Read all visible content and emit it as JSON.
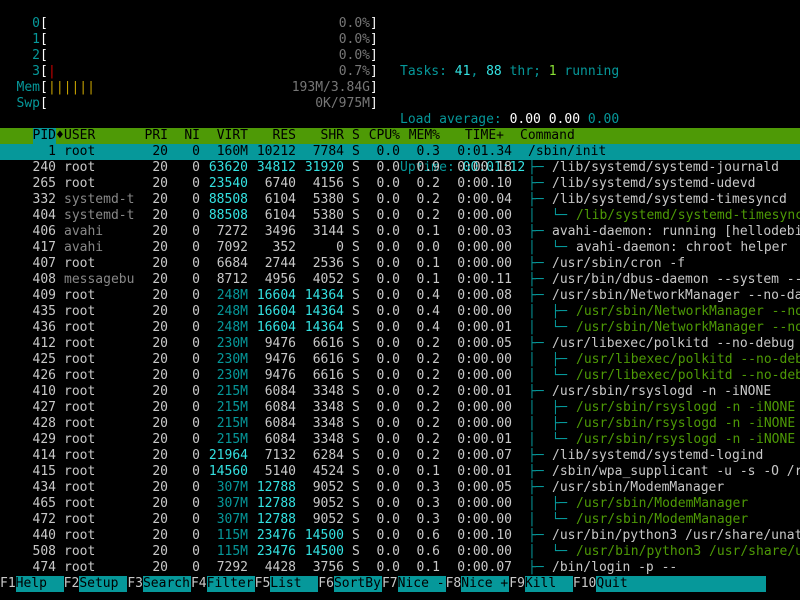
{
  "meters": [
    {
      "label": "0",
      "bar": "",
      "bar_color": "#4e9a06",
      "value": "0.0%"
    },
    {
      "label": "1",
      "bar": "",
      "bar_color": "#4e9a06",
      "value": "0.0%"
    },
    {
      "label": "2",
      "bar": "",
      "bar_color": "#4e9a06",
      "value": "0.0%"
    },
    {
      "label": "3",
      "bar": "|",
      "bar_color": "#cc0000",
      "value": "0.7%"
    },
    {
      "label": "Mem",
      "bar": "||||||",
      "bar_color": "#c4a000",
      "value": "193M/3.84G"
    },
    {
      "label": "Swp",
      "bar": "",
      "bar_color": "#cc0000",
      "value": "0K/975M"
    }
  ],
  "summary": {
    "tasks_label": "Tasks: ",
    "tasks": "41",
    "thr_sep": ", ",
    "thr": "88",
    "thr_label": " thr; ",
    "running": "1",
    "running_label": " running",
    "load_label": "Load average: ",
    "load1": "0.00",
    "load5": "0.00",
    "load15": "0.00",
    "uptime_label": "Uptime: ",
    "uptime": "00:01:12"
  },
  "columns": [
    "PID",
    "USER",
    "PRI",
    "NI",
    "VIRT",
    "RES",
    "SHR",
    "S",
    "CPU%",
    "MEM%",
    "TIME+",
    "Command"
  ],
  "sort_column": "PID",
  "sort_indicator": "♦",
  "processes": [
    {
      "pid": "1",
      "user": "root",
      "pri": "20",
      "ni": "0",
      "virt": "160M",
      "res": "10212",
      "shr": "7784",
      "s": "S",
      "cpu": "0.0",
      "mem": "0.3",
      "time": "0:01.34",
      "tree": "",
      "cmd": "/sbin/init",
      "thread": false
    },
    {
      "pid": "240",
      "user": "root",
      "pri": "20",
      "ni": "0",
      "virt": "63620",
      "res": "34812",
      "shr": "31920",
      "s": "S",
      "cpu": "0.0",
      "mem": "0.9",
      "time": "0:00.18",
      "tree": "├─ ",
      "cmd": "/lib/systemd/systemd-journald",
      "thread": false
    },
    {
      "pid": "265",
      "user": "root",
      "pri": "20",
      "ni": "0",
      "virt": "23540",
      "res": "6740",
      "shr": "4156",
      "s": "S",
      "cpu": "0.0",
      "mem": "0.2",
      "time": "0:00.10",
      "tree": "├─ ",
      "cmd": "/lib/systemd/systemd-udevd",
      "thread": false
    },
    {
      "pid": "332",
      "user": "systemd-t",
      "pri": "20",
      "ni": "0",
      "virt": "88508",
      "res": "6104",
      "shr": "5380",
      "s": "S",
      "cpu": "0.0",
      "mem": "0.2",
      "time": "0:00.04",
      "tree": "├─ ",
      "cmd": "/lib/systemd/systemd-timesyncd",
      "thread": false
    },
    {
      "pid": "404",
      "user": "systemd-t",
      "pri": "20",
      "ni": "0",
      "virt": "88508",
      "res": "6104",
      "shr": "5380",
      "s": "S",
      "cpu": "0.0",
      "mem": "0.2",
      "time": "0:00.00",
      "tree": "│  └─ ",
      "cmd": "/lib/systemd/systemd-timesyncd",
      "thread": true
    },
    {
      "pid": "406",
      "user": "avahi",
      "pri": "20",
      "ni": "0",
      "virt": "7272",
      "res": "3496",
      "shr": "3144",
      "s": "S",
      "cpu": "0.0",
      "mem": "0.1",
      "time": "0:00.03",
      "tree": "├─ ",
      "cmd": "avahi-daemon: running [hellodebi",
      "thread": false
    },
    {
      "pid": "417",
      "user": "avahi",
      "pri": "20",
      "ni": "0",
      "virt": "7092",
      "res": "352",
      "shr": "0",
      "s": "S",
      "cpu": "0.0",
      "mem": "0.0",
      "time": "0:00.00",
      "tree": "│  └─ ",
      "cmd": "avahi-daemon: chroot helper",
      "thread": false
    },
    {
      "pid": "407",
      "user": "root",
      "pri": "20",
      "ni": "0",
      "virt": "6684",
      "res": "2744",
      "shr": "2536",
      "s": "S",
      "cpu": "0.0",
      "mem": "0.1",
      "time": "0:00.00",
      "tree": "├─ ",
      "cmd": "/usr/sbin/cron -f",
      "thread": false
    },
    {
      "pid": "408",
      "user": "messagebu",
      "pri": "20",
      "ni": "0",
      "virt": "8712",
      "res": "4956",
      "shr": "4052",
      "s": "S",
      "cpu": "0.0",
      "mem": "0.1",
      "time": "0:00.11",
      "tree": "├─ ",
      "cmd": "/usr/bin/dbus-daemon --system --",
      "thread": false
    },
    {
      "pid": "409",
      "user": "root",
      "pri": "20",
      "ni": "0",
      "virt": "248M",
      "res": "16604",
      "shr": "14364",
      "s": "S",
      "cpu": "0.0",
      "mem": "0.4",
      "time": "0:00.08",
      "tree": "├─ ",
      "cmd": "/usr/sbin/NetworkManager --no-da",
      "thread": false
    },
    {
      "pid": "435",
      "user": "root",
      "pri": "20",
      "ni": "0",
      "virt": "248M",
      "res": "16604",
      "shr": "14364",
      "s": "S",
      "cpu": "0.0",
      "mem": "0.4",
      "time": "0:00.00",
      "tree": "│  ├─ ",
      "cmd": "/usr/sbin/NetworkManager --no",
      "thread": true
    },
    {
      "pid": "436",
      "user": "root",
      "pri": "20",
      "ni": "0",
      "virt": "248M",
      "res": "16604",
      "shr": "14364",
      "s": "S",
      "cpu": "0.0",
      "mem": "0.4",
      "time": "0:00.01",
      "tree": "│  └─ ",
      "cmd": "/usr/sbin/NetworkManager --no",
      "thread": true
    },
    {
      "pid": "412",
      "user": "root",
      "pri": "20",
      "ni": "0",
      "virt": "230M",
      "res": "9476",
      "shr": "6616",
      "s": "S",
      "cpu": "0.0",
      "mem": "0.2",
      "time": "0:00.05",
      "tree": "├─ ",
      "cmd": "/usr/libexec/polkitd --no-debug",
      "thread": false
    },
    {
      "pid": "425",
      "user": "root",
      "pri": "20",
      "ni": "0",
      "virt": "230M",
      "res": "9476",
      "shr": "6616",
      "s": "S",
      "cpu": "0.0",
      "mem": "0.2",
      "time": "0:00.00",
      "tree": "│  ├─ ",
      "cmd": "/usr/libexec/polkitd --no-deb",
      "thread": true
    },
    {
      "pid": "426",
      "user": "root",
      "pri": "20",
      "ni": "0",
      "virt": "230M",
      "res": "9476",
      "shr": "6616",
      "s": "S",
      "cpu": "0.0",
      "mem": "0.2",
      "time": "0:00.00",
      "tree": "│  └─ ",
      "cmd": "/usr/libexec/polkitd --no-deb",
      "thread": true
    },
    {
      "pid": "410",
      "user": "root",
      "pri": "20",
      "ni": "0",
      "virt": "215M",
      "res": "6084",
      "shr": "3348",
      "s": "S",
      "cpu": "0.0",
      "mem": "0.2",
      "time": "0:00.01",
      "tree": "├─ ",
      "cmd": "/usr/sbin/rsyslogd -n -iNONE",
      "thread": false
    },
    {
      "pid": "427",
      "user": "root",
      "pri": "20",
      "ni": "0",
      "virt": "215M",
      "res": "6084",
      "shr": "3348",
      "s": "S",
      "cpu": "0.0",
      "mem": "0.2",
      "time": "0:00.00",
      "tree": "│  ├─ ",
      "cmd": "/usr/sbin/rsyslogd -n -iNONE",
      "thread": true
    },
    {
      "pid": "428",
      "user": "root",
      "pri": "20",
      "ni": "0",
      "virt": "215M",
      "res": "6084",
      "shr": "3348",
      "s": "S",
      "cpu": "0.0",
      "mem": "0.2",
      "time": "0:00.00",
      "tree": "│  ├─ ",
      "cmd": "/usr/sbin/rsyslogd -n -iNONE",
      "thread": true
    },
    {
      "pid": "429",
      "user": "root",
      "pri": "20",
      "ni": "0",
      "virt": "215M",
      "res": "6084",
      "shr": "3348",
      "s": "S",
      "cpu": "0.0",
      "mem": "0.2",
      "time": "0:00.01",
      "tree": "│  └─ ",
      "cmd": "/usr/sbin/rsyslogd -n -iNONE",
      "thread": true
    },
    {
      "pid": "414",
      "user": "root",
      "pri": "20",
      "ni": "0",
      "virt": "21964",
      "res": "7132",
      "shr": "6284",
      "s": "S",
      "cpu": "0.0",
      "mem": "0.2",
      "time": "0:00.07",
      "tree": "├─ ",
      "cmd": "/lib/systemd/systemd-logind",
      "thread": false
    },
    {
      "pid": "415",
      "user": "root",
      "pri": "20",
      "ni": "0",
      "virt": "14560",
      "res": "5140",
      "shr": "4524",
      "s": "S",
      "cpu": "0.0",
      "mem": "0.1",
      "time": "0:00.01",
      "tree": "├─ ",
      "cmd": "/sbin/wpa_supplicant -u -s -O /r",
      "thread": false
    },
    {
      "pid": "434",
      "user": "root",
      "pri": "20",
      "ni": "0",
      "virt": "307M",
      "res": "12788",
      "shr": "9052",
      "s": "S",
      "cpu": "0.0",
      "mem": "0.3",
      "time": "0:00.05",
      "tree": "├─ ",
      "cmd": "/usr/sbin/ModemManager",
      "thread": false
    },
    {
      "pid": "465",
      "user": "root",
      "pri": "20",
      "ni": "0",
      "virt": "307M",
      "res": "12788",
      "shr": "9052",
      "s": "S",
      "cpu": "0.0",
      "mem": "0.3",
      "time": "0:00.00",
      "tree": "│  ├─ ",
      "cmd": "/usr/sbin/ModemManager",
      "thread": true
    },
    {
      "pid": "472",
      "user": "root",
      "pri": "20",
      "ni": "0",
      "virt": "307M",
      "res": "12788",
      "shr": "9052",
      "s": "S",
      "cpu": "0.0",
      "mem": "0.3",
      "time": "0:00.00",
      "tree": "│  └─ ",
      "cmd": "/usr/sbin/ModemManager",
      "thread": true
    },
    {
      "pid": "440",
      "user": "root",
      "pri": "20",
      "ni": "0",
      "virt": "115M",
      "res": "23476",
      "shr": "14500",
      "s": "S",
      "cpu": "0.0",
      "mem": "0.6",
      "time": "0:00.10",
      "tree": "├─ ",
      "cmd": "/usr/bin/python3 /usr/share/unat",
      "thread": false
    },
    {
      "pid": "508",
      "user": "root",
      "pri": "20",
      "ni": "0",
      "virt": "115M",
      "res": "23476",
      "shr": "14500",
      "s": "S",
      "cpu": "0.0",
      "mem": "0.6",
      "time": "0:00.00",
      "tree": "│  └─ ",
      "cmd": "/usr/bin/python3 /usr/share/u",
      "thread": true
    },
    {
      "pid": "474",
      "user": "root",
      "pri": "20",
      "ni": "0",
      "virt": "7292",
      "res": "4428",
      "shr": "3756",
      "s": "S",
      "cpu": "0.0",
      "mem": "0.1",
      "time": "0:00.07",
      "tree": "├─ ",
      "cmd": "/bin/login -p --",
      "thread": false
    }
  ],
  "function_keys": [
    {
      "key": "F1",
      "label": "Help"
    },
    {
      "key": "F2",
      "label": "Setup"
    },
    {
      "key": "F3",
      "label": "Search"
    },
    {
      "key": "F4",
      "label": "Filter"
    },
    {
      "key": "F5",
      "label": "List"
    },
    {
      "key": "F6",
      "label": "SortBy"
    },
    {
      "key": "F7",
      "label": "Nice -"
    },
    {
      "key": "F8",
      "label": "Nice +"
    },
    {
      "key": "F9",
      "label": "Kill"
    },
    {
      "key": "F10",
      "label": "Quit"
    }
  ],
  "colors": {
    "header_bg": "#4e9a06",
    "selected_bg": "#06989a",
    "thread_cmd": "#4e9a06",
    "label": "#06989a"
  }
}
